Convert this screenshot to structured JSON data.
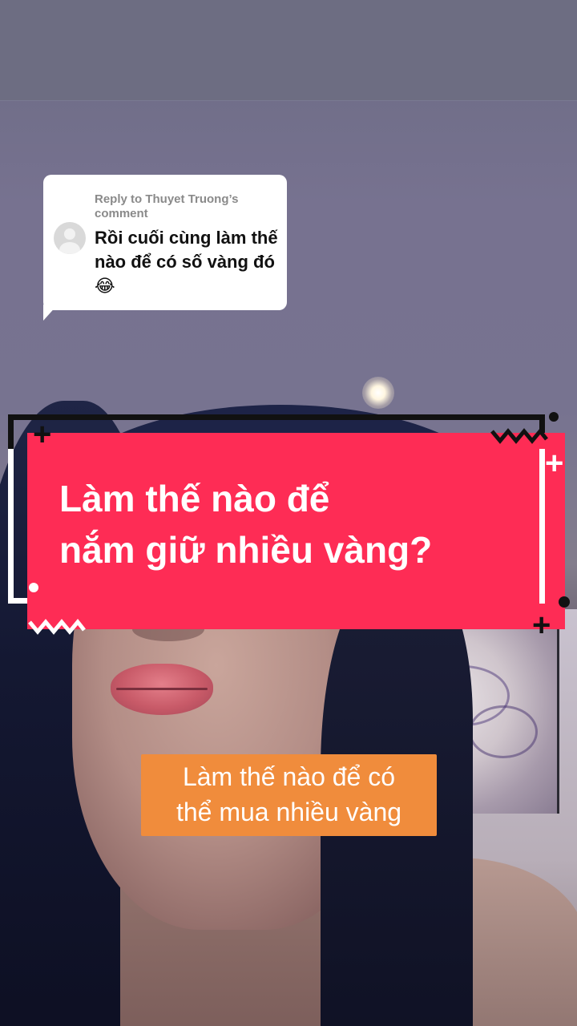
{
  "reply": {
    "heading": "Reply to Thuyet Truong’s comment",
    "comment": "Rồi cuối cùng làm thế nào để có số vàng đó 😂"
  },
  "banner": {
    "title_line1": "Làm thế nào để",
    "title_line2": "nắm giữ nhiều vàng?",
    "color": "#fe2c55"
  },
  "caption": {
    "line1": "Làm thế nào để có",
    "line2": "thể mua nhiều vàng",
    "color": "#f08c3c"
  },
  "icons": [
    "avatar-placeholder-icon",
    "plus-decoration-icon",
    "zigzag-decoration-icon",
    "dot-decoration-icon"
  ]
}
